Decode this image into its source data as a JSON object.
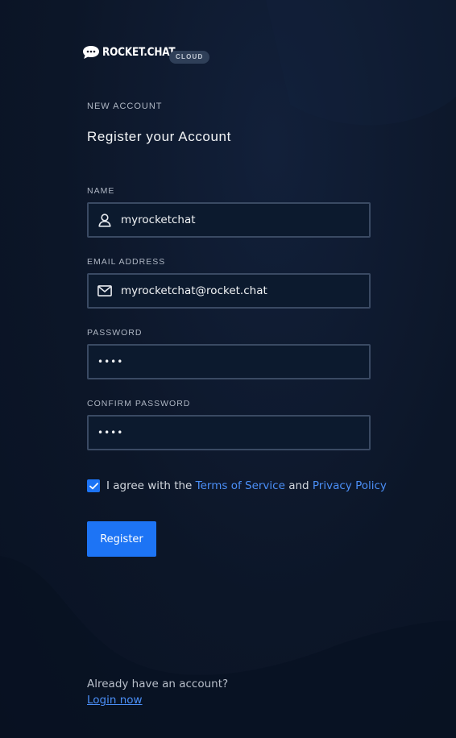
{
  "header": {
    "logo_text": "ROCKET.CHAT",
    "badge": "CLOUD",
    "kicker": "NEW ACCOUNT",
    "title": "Register your Account"
  },
  "form": {
    "name": {
      "label": "NAME",
      "value": "myrocketchat",
      "icon": "user-icon"
    },
    "email": {
      "label": "EMAIL ADDRESS",
      "value": "myrocketchat@rocket.chat",
      "icon": "mail-icon"
    },
    "password": {
      "label": "PASSWORD",
      "value": "••••"
    },
    "confirm_password": {
      "label": "CONFIRM PASSWORD",
      "value": "••••"
    },
    "agree": {
      "checked": true,
      "prefix": "I agree with the",
      "terms_link": "Terms of Service",
      "middle": "and",
      "privacy_link": "Privacy Policy"
    },
    "submit_label": "Register"
  },
  "footer": {
    "prompt": "Already have an account?",
    "login_link": "Login now"
  },
  "colors": {
    "background": "#0b1528",
    "accent": "#1d74f5",
    "link": "#4b8ff7",
    "field_border": "#3a4a63"
  }
}
